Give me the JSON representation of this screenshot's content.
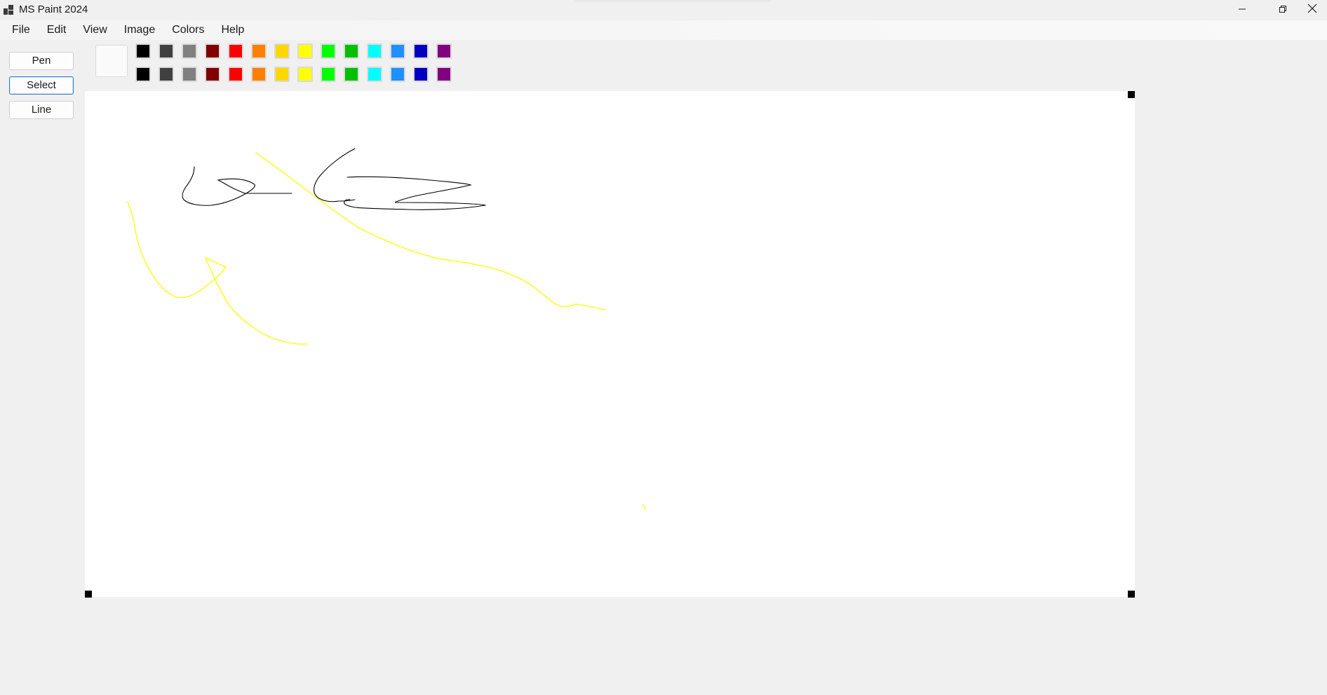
{
  "window": {
    "title": "MS Paint 2024",
    "app_icon": "paint-app-icon",
    "controls": [
      "minimize-icon",
      "restore-icon",
      "close-icon"
    ]
  },
  "menu": {
    "items": [
      "File",
      "Edit",
      "View",
      "Image",
      "Colors",
      "Help"
    ]
  },
  "tools": {
    "items": [
      {
        "label": "Pen",
        "selected": false
      },
      {
        "label": "Select",
        "selected": true
      },
      {
        "label": "Line",
        "selected": false
      }
    ]
  },
  "current_color": "#fafafa",
  "palette": {
    "rows": [
      [
        "#000000",
        "#404040",
        "#808080",
        "#800000",
        "#ff0000",
        "#ff8000",
        "#ffd700",
        "#ffff00",
        "#00ff00",
        "#00c000",
        "#00ffff",
        "#1e90ff",
        "#0000c0",
        "#800080"
      ],
      [
        "#000000",
        "#404040",
        "#808080",
        "#800000",
        "#ff0000",
        "#ff8000",
        "#ffd700",
        "#ffff00",
        "#00ff00",
        "#00c000",
        "#00ffff",
        "#1e90ff",
        "#0000c0",
        "#800080"
      ]
    ]
  },
  "canvas": {
    "background": "#ffffff",
    "stroke_colors": {
      "black": "#000000",
      "yellow": "#ffff00"
    }
  }
}
